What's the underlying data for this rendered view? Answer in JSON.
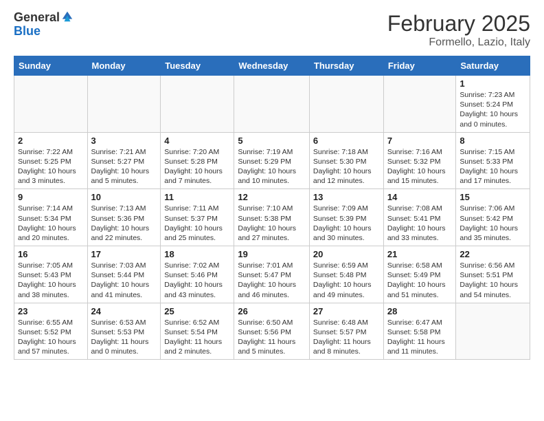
{
  "logo": {
    "general": "General",
    "blue": "Blue"
  },
  "title": "February 2025",
  "subtitle": "Formello, Lazio, Italy",
  "days_of_week": [
    "Sunday",
    "Monday",
    "Tuesday",
    "Wednesday",
    "Thursday",
    "Friday",
    "Saturday"
  ],
  "weeks": [
    [
      {
        "num": "",
        "info": ""
      },
      {
        "num": "",
        "info": ""
      },
      {
        "num": "",
        "info": ""
      },
      {
        "num": "",
        "info": ""
      },
      {
        "num": "",
        "info": ""
      },
      {
        "num": "",
        "info": ""
      },
      {
        "num": "1",
        "info": "Sunrise: 7:23 AM\nSunset: 5:24 PM\nDaylight: 10 hours\nand 0 minutes."
      }
    ],
    [
      {
        "num": "2",
        "info": "Sunrise: 7:22 AM\nSunset: 5:25 PM\nDaylight: 10 hours\nand 3 minutes."
      },
      {
        "num": "3",
        "info": "Sunrise: 7:21 AM\nSunset: 5:27 PM\nDaylight: 10 hours\nand 5 minutes."
      },
      {
        "num": "4",
        "info": "Sunrise: 7:20 AM\nSunset: 5:28 PM\nDaylight: 10 hours\nand 7 minutes."
      },
      {
        "num": "5",
        "info": "Sunrise: 7:19 AM\nSunset: 5:29 PM\nDaylight: 10 hours\nand 10 minutes."
      },
      {
        "num": "6",
        "info": "Sunrise: 7:18 AM\nSunset: 5:30 PM\nDaylight: 10 hours\nand 12 minutes."
      },
      {
        "num": "7",
        "info": "Sunrise: 7:16 AM\nSunset: 5:32 PM\nDaylight: 10 hours\nand 15 minutes."
      },
      {
        "num": "8",
        "info": "Sunrise: 7:15 AM\nSunset: 5:33 PM\nDaylight: 10 hours\nand 17 minutes."
      }
    ],
    [
      {
        "num": "9",
        "info": "Sunrise: 7:14 AM\nSunset: 5:34 PM\nDaylight: 10 hours\nand 20 minutes."
      },
      {
        "num": "10",
        "info": "Sunrise: 7:13 AM\nSunset: 5:36 PM\nDaylight: 10 hours\nand 22 minutes."
      },
      {
        "num": "11",
        "info": "Sunrise: 7:11 AM\nSunset: 5:37 PM\nDaylight: 10 hours\nand 25 minutes."
      },
      {
        "num": "12",
        "info": "Sunrise: 7:10 AM\nSunset: 5:38 PM\nDaylight: 10 hours\nand 27 minutes."
      },
      {
        "num": "13",
        "info": "Sunrise: 7:09 AM\nSunset: 5:39 PM\nDaylight: 10 hours\nand 30 minutes."
      },
      {
        "num": "14",
        "info": "Sunrise: 7:08 AM\nSunset: 5:41 PM\nDaylight: 10 hours\nand 33 minutes."
      },
      {
        "num": "15",
        "info": "Sunrise: 7:06 AM\nSunset: 5:42 PM\nDaylight: 10 hours\nand 35 minutes."
      }
    ],
    [
      {
        "num": "16",
        "info": "Sunrise: 7:05 AM\nSunset: 5:43 PM\nDaylight: 10 hours\nand 38 minutes."
      },
      {
        "num": "17",
        "info": "Sunrise: 7:03 AM\nSunset: 5:44 PM\nDaylight: 10 hours\nand 41 minutes."
      },
      {
        "num": "18",
        "info": "Sunrise: 7:02 AM\nSunset: 5:46 PM\nDaylight: 10 hours\nand 43 minutes."
      },
      {
        "num": "19",
        "info": "Sunrise: 7:01 AM\nSunset: 5:47 PM\nDaylight: 10 hours\nand 46 minutes."
      },
      {
        "num": "20",
        "info": "Sunrise: 6:59 AM\nSunset: 5:48 PM\nDaylight: 10 hours\nand 49 minutes."
      },
      {
        "num": "21",
        "info": "Sunrise: 6:58 AM\nSunset: 5:49 PM\nDaylight: 10 hours\nand 51 minutes."
      },
      {
        "num": "22",
        "info": "Sunrise: 6:56 AM\nSunset: 5:51 PM\nDaylight: 10 hours\nand 54 minutes."
      }
    ],
    [
      {
        "num": "23",
        "info": "Sunrise: 6:55 AM\nSunset: 5:52 PM\nDaylight: 10 hours\nand 57 minutes."
      },
      {
        "num": "24",
        "info": "Sunrise: 6:53 AM\nSunset: 5:53 PM\nDaylight: 11 hours\nand 0 minutes."
      },
      {
        "num": "25",
        "info": "Sunrise: 6:52 AM\nSunset: 5:54 PM\nDaylight: 11 hours\nand 2 minutes."
      },
      {
        "num": "26",
        "info": "Sunrise: 6:50 AM\nSunset: 5:56 PM\nDaylight: 11 hours\nand 5 minutes."
      },
      {
        "num": "27",
        "info": "Sunrise: 6:48 AM\nSunset: 5:57 PM\nDaylight: 11 hours\nand 8 minutes."
      },
      {
        "num": "28",
        "info": "Sunrise: 6:47 AM\nSunset: 5:58 PM\nDaylight: 11 hours\nand 11 minutes."
      },
      {
        "num": "",
        "info": ""
      }
    ]
  ]
}
